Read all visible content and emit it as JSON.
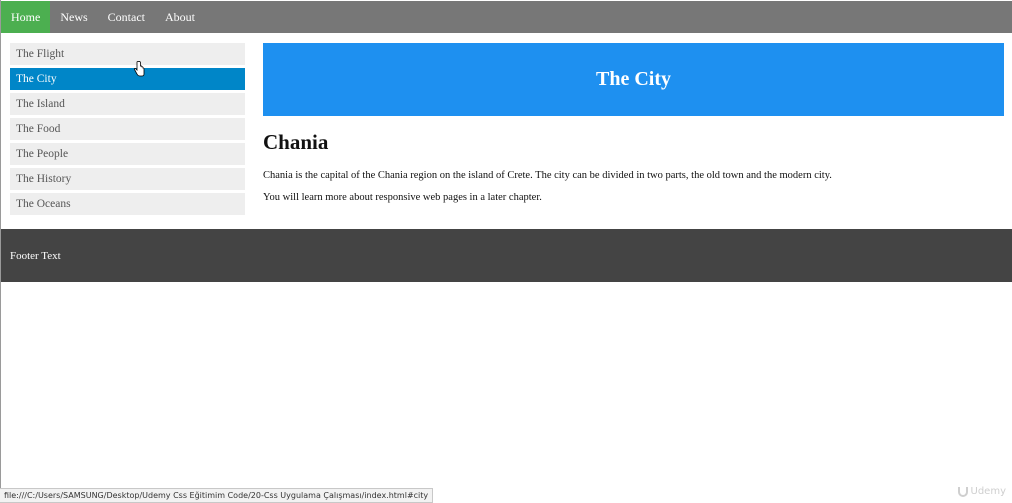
{
  "topnav": {
    "items": [
      {
        "label": "Home",
        "active": true
      },
      {
        "label": "News",
        "active": false
      },
      {
        "label": "Contact",
        "active": false
      },
      {
        "label": "About",
        "active": false
      }
    ]
  },
  "sidebar": {
    "items": [
      {
        "label": "The Flight",
        "active": false
      },
      {
        "label": "The City",
        "active": true
      },
      {
        "label": "The Island",
        "active": false
      },
      {
        "label": "The Food",
        "active": false
      },
      {
        "label": "The People",
        "active": false
      },
      {
        "label": "The History",
        "active": false
      },
      {
        "label": "The Oceans",
        "active": false
      }
    ]
  },
  "main": {
    "banner_title": "The City",
    "heading": "Chania",
    "paragraph1": "Chania is the capital of the Chania region on the island of Crete. The city can be divided in two parts, the old town and the modern city.",
    "paragraph2": "You will learn more about responsive web pages in a later chapter."
  },
  "footer": {
    "text": "Footer Text"
  },
  "statusbar": {
    "url": "file:///C:/Users/SAMSUNG/Desktop/Udemy Css Eğitimim Code/20-Css Uygulama Çalışması/index.html#city"
  },
  "watermark": {
    "text": "Udemy"
  },
  "colors": {
    "nav_bg": "#777777",
    "nav_active": "#4caf50",
    "side_active": "#0086c8",
    "banner_bg": "#1e90f0",
    "footer_bg": "#444444"
  }
}
